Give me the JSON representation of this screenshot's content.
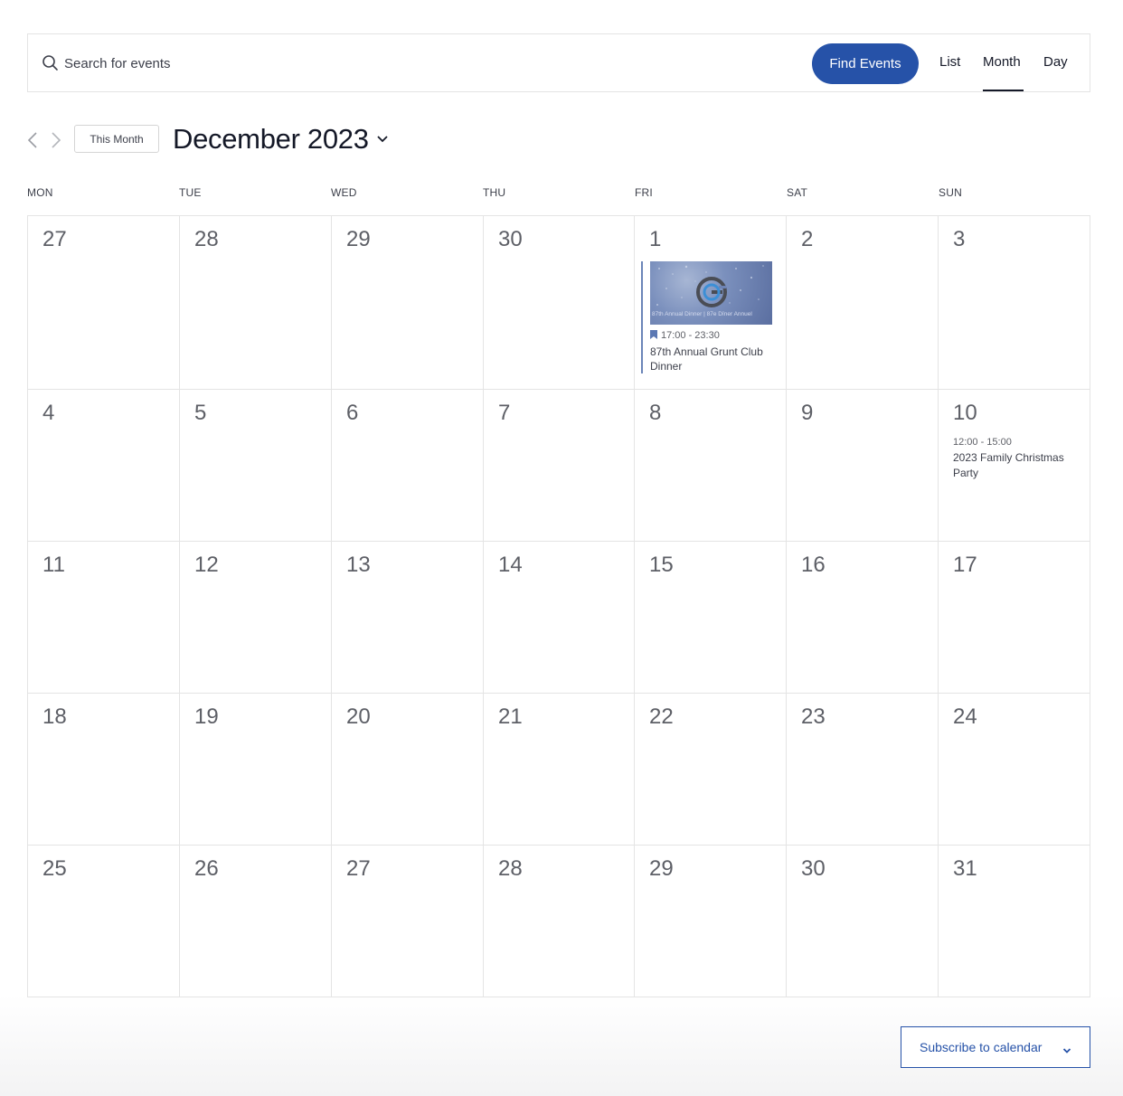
{
  "search": {
    "placeholder": "Search for events",
    "find_button": "Find Events"
  },
  "views": {
    "list": "List",
    "month": "Month",
    "day": "Day",
    "active": "Month"
  },
  "nav": {
    "this_month": "This Month",
    "title": "December 2023"
  },
  "weekdays": [
    "MON",
    "TUE",
    "WED",
    "THU",
    "FRI",
    "SAT",
    "SUN"
  ],
  "days": [
    "27",
    "28",
    "29",
    "30",
    "1",
    "2",
    "3",
    "4",
    "5",
    "6",
    "7",
    "8",
    "9",
    "10",
    "11",
    "12",
    "13",
    "14",
    "15",
    "16",
    "17",
    "18",
    "19",
    "20",
    "21",
    "22",
    "23",
    "24",
    "25",
    "26",
    "27",
    "28",
    "29",
    "30",
    "31"
  ],
  "events": {
    "grunt_dinner": {
      "time": "17:00 - 23:30",
      "title": "87th Annual Grunt Club Dinner",
      "image_caption": "87th Annual Dinner | 87e Dîner Annuel",
      "featured": true
    },
    "christmas_party": {
      "time": "12:00 - 15:00",
      "title": "2023 Family Christmas Party"
    }
  },
  "subscribe": {
    "label": "Subscribe to calendar"
  },
  "colors": {
    "accent": "#2652a8",
    "text": "#141827",
    "muted": "#5d5f66",
    "border": "#e4e4e4"
  }
}
